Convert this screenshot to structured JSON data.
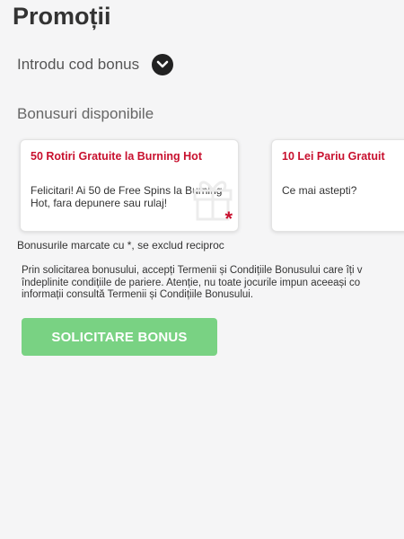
{
  "page": {
    "title": "Promoții"
  },
  "bonus_code": {
    "label": "Introdu cod bonus",
    "icon": "chevron-down-icon"
  },
  "available": {
    "title": "Bonusuri disponibile"
  },
  "cards": [
    {
      "title": "50 Rotiri Gratuite la Burning Hot",
      "description": "Felicitari! Ai 50 de Free Spins la Burning Hot, fara depunere sau rulaj!",
      "marker": "*",
      "icon": "gift-icon"
    },
    {
      "title": "10 Lei Pariu Gratuit",
      "description": "Ce mai astepti?"
    }
  ],
  "note": "Bonusurile marcate cu *, se exclud reciproc",
  "terms": {
    "line1": "Prin solicitarea bonusului, accepți Termenii și Condițiile Bonusului care îți v",
    "line2": "îndeplinite condițiile de pariere. Atenție, nu toate jocurile impun aceeași co",
    "line3": "informații consultă Termenii și Condițiile Bonusului."
  },
  "cta": {
    "label": "SOLICITARE BONUS"
  },
  "colors": {
    "accent_red": "#c8102e",
    "cta_green": "#79d283"
  }
}
